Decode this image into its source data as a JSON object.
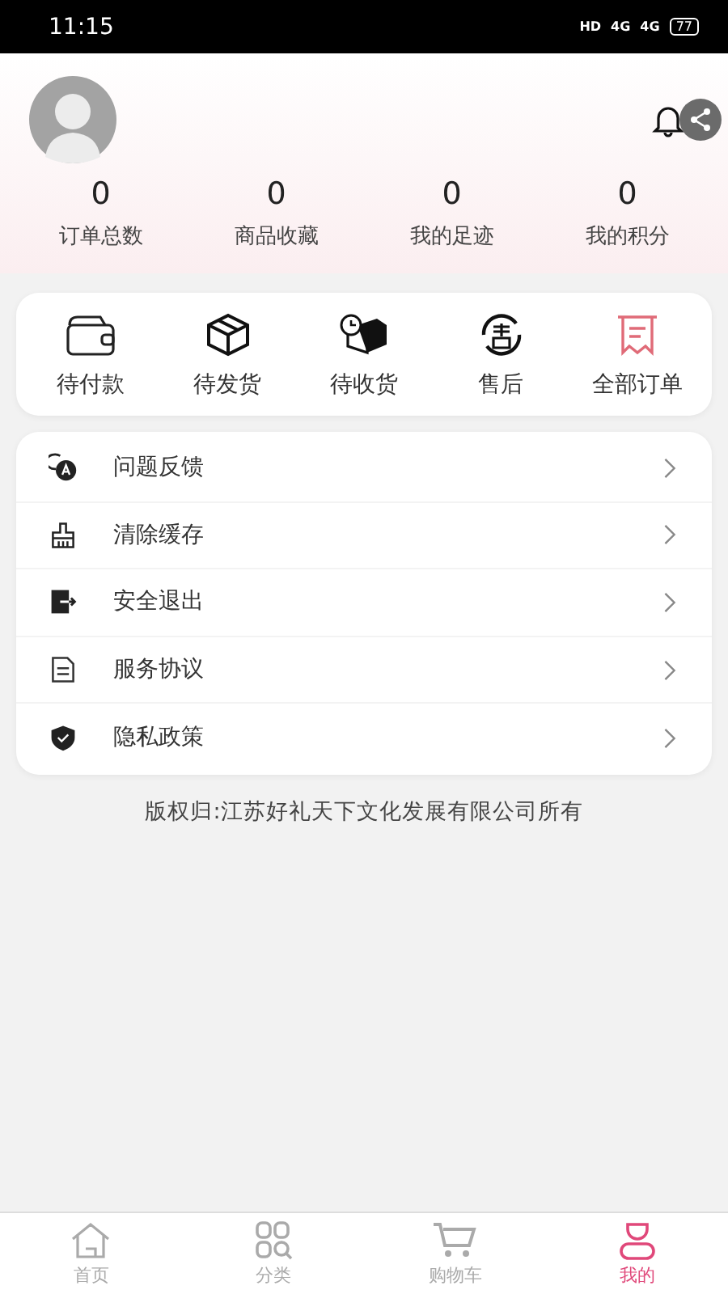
{
  "status_bar": {
    "time": "11:15",
    "indicators": [
      "HD",
      "4G",
      "4G"
    ],
    "battery": "77"
  },
  "header": {
    "stats": [
      {
        "value": "0",
        "label": "订单总数"
      },
      {
        "value": "0",
        "label": "商品收藏"
      },
      {
        "value": "0",
        "label": "我的足迹"
      },
      {
        "value": "0",
        "label": "我的积分"
      }
    ]
  },
  "orders": [
    {
      "label": "待付款"
    },
    {
      "label": "待发货"
    },
    {
      "label": "待收货"
    },
    {
      "label": "售后"
    },
    {
      "label": "全部订单"
    }
  ],
  "menu": [
    {
      "label": "问题反馈"
    },
    {
      "label": "清除缓存"
    },
    {
      "label": "安全退出"
    },
    {
      "label": "服务协议"
    },
    {
      "label": "隐私政策"
    }
  ],
  "copyright": "版权归:江苏好礼天下文化发展有限公司所有",
  "tabs": [
    {
      "label": "首页",
      "selected": false
    },
    {
      "label": "分类",
      "selected": false
    },
    {
      "label": "购物车",
      "selected": false
    },
    {
      "label": "我的",
      "selected": true
    }
  ]
}
